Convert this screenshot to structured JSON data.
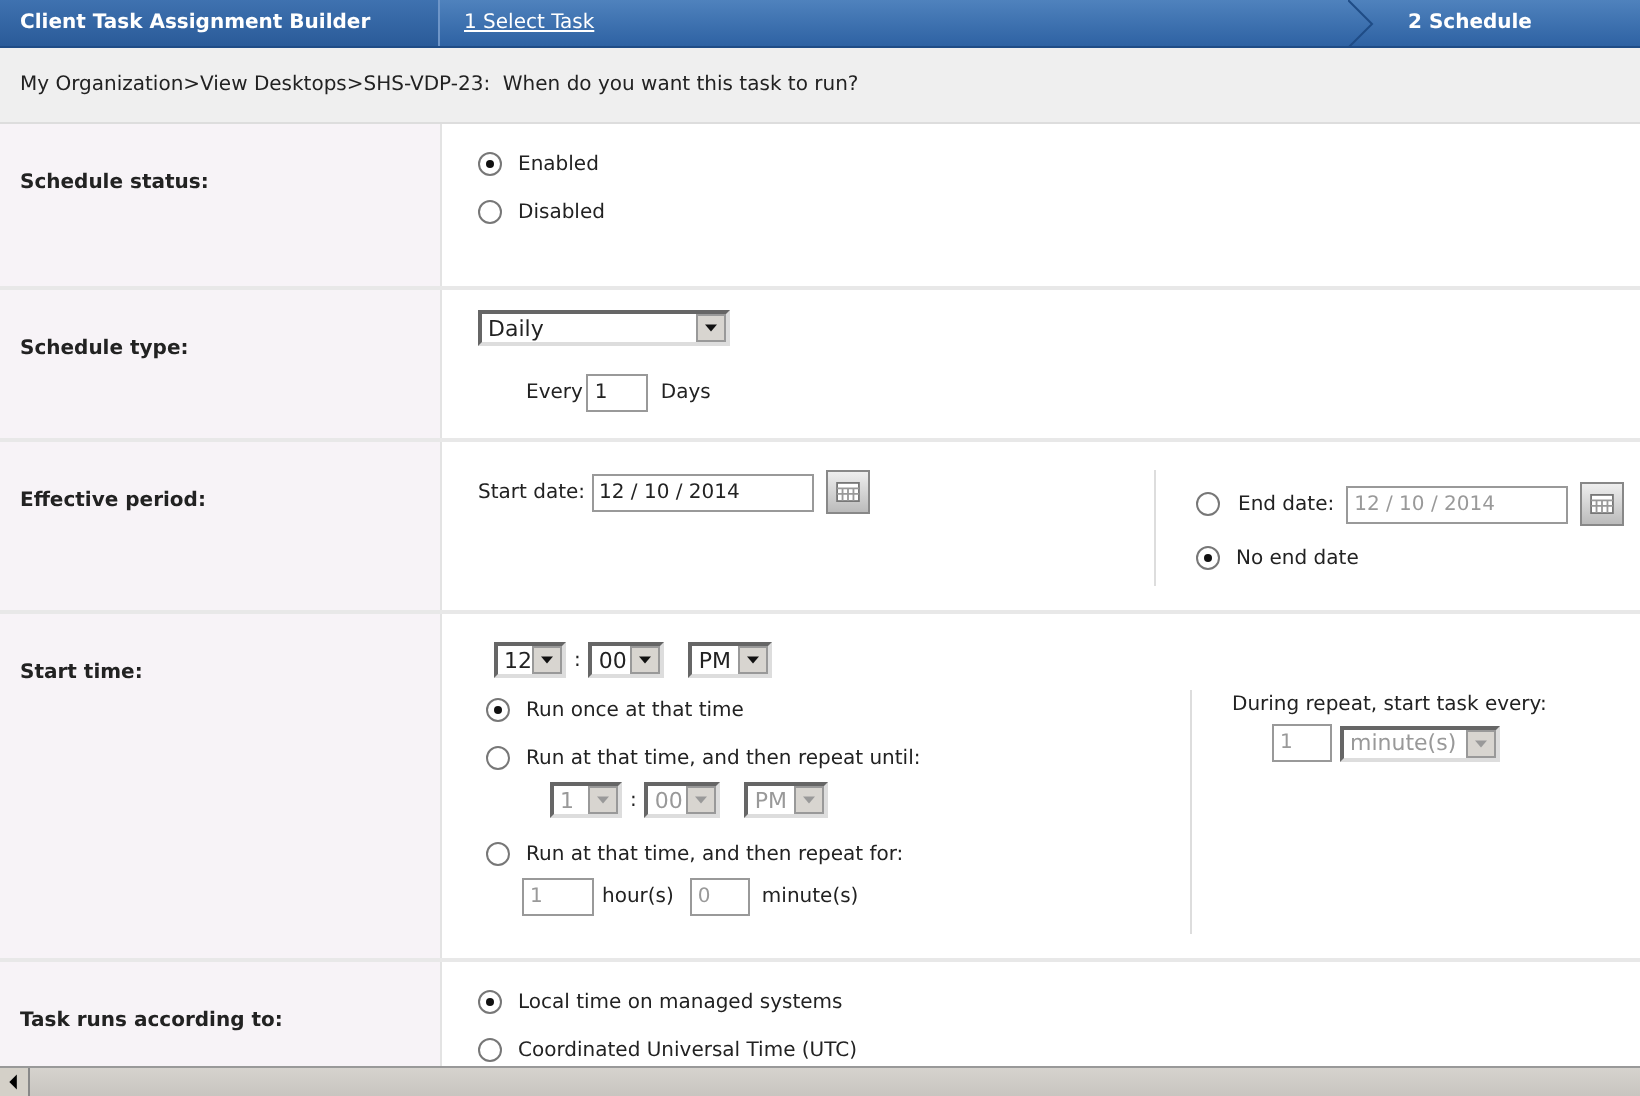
{
  "header": {
    "title": "Client Task Assignment Builder",
    "steps": [
      {
        "label": "1 Select Task",
        "selected": false
      },
      {
        "label": "2 Schedule",
        "selected": true
      }
    ]
  },
  "breadcrumb": "My Organization>View Desktops>SHS-VDP-23:  When do you want this task to run?",
  "sections": [
    {
      "kind": "radios",
      "label": "Schedule status:",
      "options": [
        {
          "label": "Enabled",
          "selected": true
        },
        {
          "label": "Disabled",
          "selected": false
        }
      ]
    },
    {
      "kind": "schedule_type",
      "label": "Schedule type:",
      "select": {
        "value": "Daily"
      },
      "every": {
        "prefix": "Every",
        "value": "1",
        "suffix": "Days"
      }
    },
    {
      "kind": "period",
      "label": "Effective period:",
      "start": {
        "label": "Start date:",
        "value": "12 / 10 / 2014",
        "disabled": false
      },
      "end": {
        "label": "End date:",
        "value": "12 / 10 / 2014",
        "selected": false,
        "disabled": true
      },
      "no_end": {
        "label": "No end date",
        "selected": true
      }
    },
    {
      "kind": "start_time",
      "label": "Start time:",
      "time": {
        "hour": "12",
        "separator": ":",
        "minute": "00",
        "ampm": "PM",
        "disabled": false
      },
      "options": [
        {
          "kind": "once",
          "label": "Run once at that time",
          "selected": true
        },
        {
          "kind": "until",
          "label": "Run at that time, and then repeat until:",
          "selected": false,
          "time": {
            "hour": "1",
            "separator": ":",
            "minute": "00",
            "ampm": "PM",
            "disabled": true
          }
        },
        {
          "kind": "for",
          "label": "Run at that time, and then repeat for:",
          "selected": false,
          "hours": {
            "value": "1",
            "unit": "hour(s)"
          },
          "minutes": {
            "value": "0",
            "unit": "minute(s)"
          },
          "disabled": true
        }
      ],
      "repeat_every": {
        "label": "During repeat, start task every:",
        "value": "1",
        "unit": "minute(s)",
        "disabled": true
      }
    },
    {
      "kind": "radios",
      "label": "Task runs according to:",
      "options": [
        {
          "label": "Local time on managed systems",
          "selected": true
        },
        {
          "label": "Coordinated Universal Time (UTC)",
          "selected": false
        }
      ]
    }
  ]
}
